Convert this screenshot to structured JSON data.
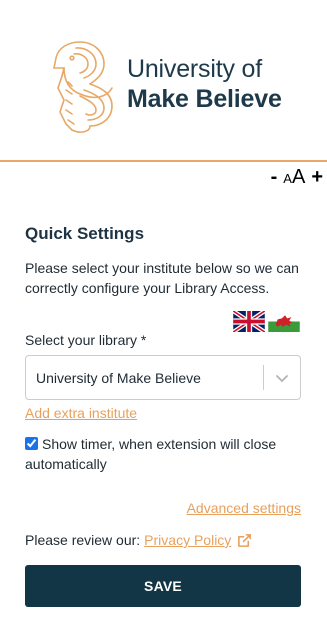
{
  "brand": {
    "line1": "University of",
    "line2": "Make Believe",
    "mark_icon": "seahorse-logo-icon",
    "accent_color": "#e8a866",
    "text_color": "#1e3a4a"
  },
  "font_controls": {
    "decrease": "-",
    "small_a": "A",
    "large_a": "A",
    "increase": "+"
  },
  "settings": {
    "title": "Quick Settings",
    "description": "Please select your institute below so we can correctly configure your Library Access.",
    "language_flags": [
      "uk-flag-icon",
      "wales-flag-icon"
    ],
    "library_label": "Select your library *",
    "library_value": "University of Make Believe",
    "add_institute": "Add extra institute",
    "timer_label": "Show timer, when extension will close automatically",
    "timer_checked": true,
    "advanced": "Advanced settings",
    "review_text": "Please review our:",
    "privacy_link": "Privacy Policy",
    "save_label": "SAVE"
  },
  "colors": {
    "link": "#e8a05c",
    "button_bg": "#123645",
    "button_text": "#ffffff"
  }
}
